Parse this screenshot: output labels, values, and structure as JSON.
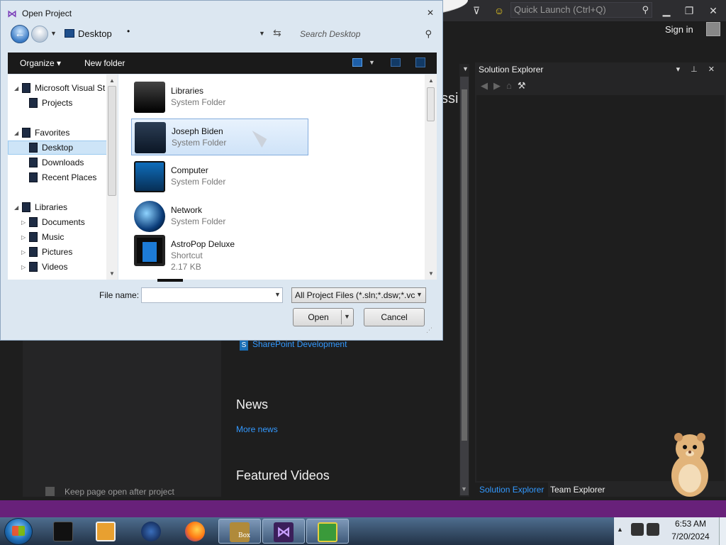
{
  "dialog": {
    "title": "Open Project",
    "address": "Desktop",
    "search_placeholder": "Search Desktop",
    "toolbar": {
      "organize": "Organize",
      "new_folder": "New folder"
    },
    "nav_tree": [
      {
        "label": "Microsoft Visual St",
        "level": 0
      },
      {
        "label": "Projects",
        "level": 1
      },
      {
        "label": "Favorites",
        "level": 0
      },
      {
        "label": "Desktop",
        "level": 1,
        "selected": true
      },
      {
        "label": "Downloads",
        "level": 1
      },
      {
        "label": "Recent Places",
        "level": 1
      },
      {
        "label": "Libraries",
        "level": 0
      },
      {
        "label": "Documents",
        "level": 1
      },
      {
        "label": "Music",
        "level": 1
      },
      {
        "label": "Pictures",
        "level": 1
      },
      {
        "label": "Videos",
        "level": 1
      }
    ],
    "files": [
      {
        "name": "Libraries",
        "type": "System Folder"
      },
      {
        "name": "Joseph Biden",
        "type": "System Folder",
        "selected": true
      },
      {
        "name": "Computer",
        "type": "System Folder"
      },
      {
        "name": "Network",
        "type": "System Folder"
      },
      {
        "name": "AstroPop Deluxe",
        "type": "Shortcut",
        "size": "2.17 KB"
      }
    ],
    "file_name_label": "File name:",
    "file_name_value": "",
    "filter_selected": "All Project Files (*.sln;*.dsw;*.vc",
    "open_label": "Open",
    "cancel_label": "Cancel"
  },
  "vs": {
    "quick_launch_placeholder": "Quick Launch (Ctrl+Q)",
    "sign_in": "Sign in",
    "partial_text": "ssi",
    "sharepoint_link": "SharePoint Development",
    "news_heading": "News",
    "more_news": "More news",
    "featured_heading": "Featured Videos",
    "keep_open": "Keep page open after project",
    "solution_explorer": {
      "title": "Solution Explorer",
      "tabs": [
        "Solution Explorer",
        "Team Explorer"
      ]
    }
  },
  "taskbar": {
    "time": "6:53 AM",
    "date": "7/20/2024",
    "pinned": [
      "black-app-icon",
      "media-player-icon",
      "globe-icon",
      "firefox-icon",
      "box-game-icon",
      "visual-studio-icon",
      "shield-app-icon"
    ],
    "box_label": "Box"
  },
  "colors": {
    "vs_background": "#1e1e1e",
    "vs_status_bar": "#68217a",
    "link_blue": "#3399ff",
    "dialog_chrome": "#dce7f1",
    "selection": "#cde4f7"
  }
}
